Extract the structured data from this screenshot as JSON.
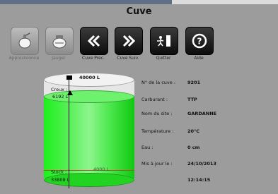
{
  "window": {
    "title": "Cuve"
  },
  "toolbar": {
    "buttons": [
      {
        "label": "Approvisionne",
        "icon": "refuel-icon",
        "enabled": false
      },
      {
        "label": "Jauger",
        "icon": "gauge-icon",
        "enabled": false
      },
      {
        "label": "Cuve Prec.",
        "icon": "double-chevron-left-icon",
        "enabled": true
      },
      {
        "label": "Cuve Suiv.",
        "icon": "double-chevron-right-icon",
        "enabled": true
      },
      {
        "label": "Quitter",
        "icon": "exit-icon",
        "enabled": true
      },
      {
        "label": "Aide",
        "icon": "help-icon",
        "enabled": true
      }
    ]
  },
  "tank": {
    "capacity_label": "40000 L",
    "creux_label": "Creux :",
    "creux_value": "6192 L",
    "stock_label": "Stock :",
    "stock_value": "33808 L",
    "limit_label": "4000 L",
    "fill_fraction": 0.845,
    "liquid_color": "#22e822"
  },
  "details": [
    {
      "label": "N° de la cuve :",
      "value": "9201"
    },
    {
      "label": "Carburant :",
      "value": "TTP"
    },
    {
      "label": "Nom du site :",
      "value": "GARDANNE"
    },
    {
      "label": "Température :",
      "value": "20°C"
    },
    {
      "label": "Eau :",
      "value": "0 cm"
    },
    {
      "label": "Mis à jour le :",
      "value": "24/10/2013"
    },
    {
      "label": "",
      "value": "12:14:15"
    }
  ]
}
